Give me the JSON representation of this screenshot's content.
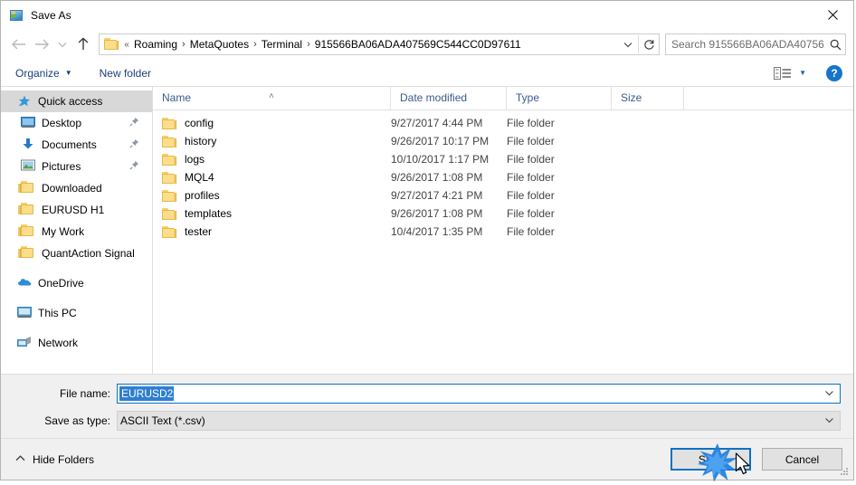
{
  "window": {
    "title": "Save As",
    "icon": "save-as-app-icon",
    "close_label": "✕"
  },
  "nav": {
    "back_icon": "arrow-left-icon",
    "forward_icon": "arrow-right-icon",
    "recent_icon": "chevron-down-icon",
    "up_icon": "arrow-up-icon",
    "folder_icon": "folder-icon",
    "overflow": "«",
    "breadcrumbs": [
      "Roaming",
      "MetaQuotes",
      "Terminal",
      "915566BA06ADA407569C544CC0D97611"
    ],
    "separator": "›",
    "dropdown_icon": "chevron-down-icon",
    "refresh_icon": "refresh-icon"
  },
  "search": {
    "placeholder": "Search 915566BA06ADA40756...",
    "icon": "search-icon"
  },
  "toolbar": {
    "organize_label": "Organize",
    "organize_caret": "▼",
    "new_folder_label": "New folder",
    "view_icon": "view-layout-icon",
    "view_caret": "▼",
    "help_label": "?"
  },
  "sidebar": {
    "items": [
      {
        "label": "Quick access",
        "icon": "quick-access-star-icon",
        "level": "root",
        "selected": true,
        "pinned": false
      },
      {
        "label": "Desktop",
        "icon": "desktop-icon",
        "level": "lvl0",
        "selected": false,
        "pinned": true
      },
      {
        "label": "Documents",
        "icon": "documents-arrow-icon",
        "level": "lvl0",
        "selected": false,
        "pinned": true
      },
      {
        "label": "Pictures",
        "icon": "pictures-icon",
        "level": "lvl0",
        "selected": false,
        "pinned": true
      },
      {
        "label": "Downloaded",
        "icon": "folder-icon",
        "level": "lvl0",
        "selected": false,
        "pinned": false
      },
      {
        "label": "EURUSD H1",
        "icon": "folder-icon",
        "level": "lvl0",
        "selected": false,
        "pinned": false
      },
      {
        "label": "My Work",
        "icon": "folder-icon",
        "level": "lvl0",
        "selected": false,
        "pinned": false
      },
      {
        "label": "QuantAction Signal",
        "icon": "folder-icon",
        "level": "lvl0",
        "selected": false,
        "pinned": false
      },
      {
        "label": "OneDrive",
        "icon": "onedrive-cloud-icon",
        "level": "root",
        "selected": false,
        "pinned": false,
        "gap_before": true
      },
      {
        "label": "This PC",
        "icon": "this-pc-icon",
        "level": "root",
        "selected": false,
        "pinned": false,
        "gap_before": true
      },
      {
        "label": "Network",
        "icon": "network-icon",
        "level": "root",
        "selected": false,
        "pinned": false,
        "gap_before": true
      }
    ]
  },
  "filelist": {
    "columns": [
      "Name",
      "Date modified",
      "Type",
      "Size"
    ],
    "sort_column": "Name",
    "sort_caret": "˄",
    "rows": [
      {
        "name": "config",
        "date": "9/27/2017 4:44 PM",
        "type": "File folder",
        "size": ""
      },
      {
        "name": "history",
        "date": "9/26/2017 10:17 PM",
        "type": "File folder",
        "size": ""
      },
      {
        "name": "logs",
        "date": "10/10/2017 1:17 PM",
        "type": "File folder",
        "size": ""
      },
      {
        "name": "MQL4",
        "date": "9/26/2017 1:08 PM",
        "type": "File folder",
        "size": ""
      },
      {
        "name": "profiles",
        "date": "9/27/2017 4:21 PM",
        "type": "File folder",
        "size": ""
      },
      {
        "name": "templates",
        "date": "9/26/2017 1:08 PM",
        "type": "File folder",
        "size": ""
      },
      {
        "name": "tester",
        "date": "10/4/2017 1:35 PM",
        "type": "File folder",
        "size": ""
      }
    ]
  },
  "form": {
    "filename_label": "File name:",
    "filename_value": "EURUSD2",
    "filetype_label": "Save as type:",
    "filetype_value": "ASCII Text (*.csv)",
    "dropdown_icon": "chevron-down-icon"
  },
  "footer": {
    "hide_folders_label": "Hide Folders",
    "hide_folders_caret": "˄",
    "save_label": "Save",
    "cancel_label": "Cancel"
  },
  "colors": {
    "accent_blue": "#0b72c4",
    "selection_blue": "#2f7fd1",
    "header_text": "#3a5a8c",
    "toolbar_link": "#1c3f7a",
    "sidebar_selected": "#d8d8d8",
    "panel_grey": "#f0f0f0",
    "folder_yellow": "#fcdd8a",
    "help_blue": "#1874c8"
  }
}
